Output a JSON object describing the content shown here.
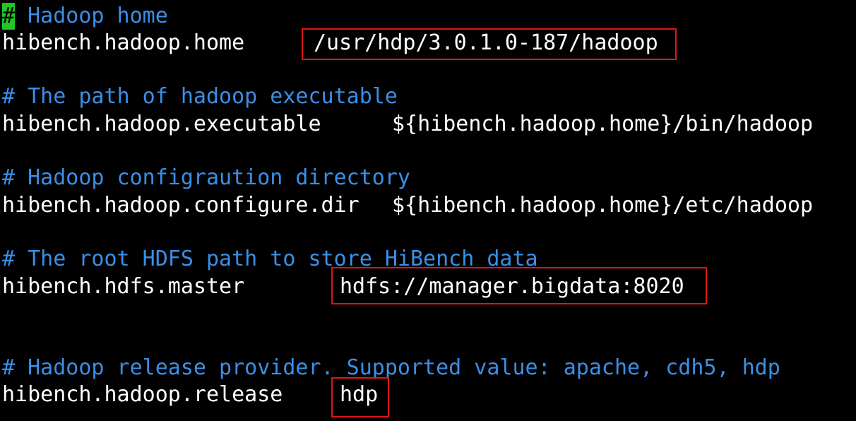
{
  "editor": {
    "lines": [
      {
        "cursor_char": "#",
        "comment": " Hadoop home"
      },
      {
        "key": "hibench.hadoop.home",
        "value": "/usr/hdp/3.0.1.0-187/hadoop"
      },
      {
        "comment": "# The path of hadoop executable"
      },
      {
        "key": "hibench.hadoop.executable",
        "value": "${hibench.hadoop.home}/bin/hadoop"
      },
      {
        "comment": "# Hadoop configraution directory"
      },
      {
        "key": "hibench.hadoop.configure.dir",
        "value": "${hibench.hadoop.home}/etc/hadoop"
      },
      {
        "comment": "# The root HDFS path to store HiBench data"
      },
      {
        "key": "hibench.hdfs.master",
        "value": "hdfs://manager.bigdata:8020"
      },
      {
        "comment": "# Hadoop release provider. Supported value: apache, cdh5, hdp"
      },
      {
        "key": "hibench.hadoop.release",
        "value": "hdp"
      }
    ]
  },
  "colors": {
    "background": "#000000",
    "text": "#ffffff",
    "comment": "#3a8fe6",
    "cursor": "#22c523",
    "highlight_box": "#e01515"
  }
}
